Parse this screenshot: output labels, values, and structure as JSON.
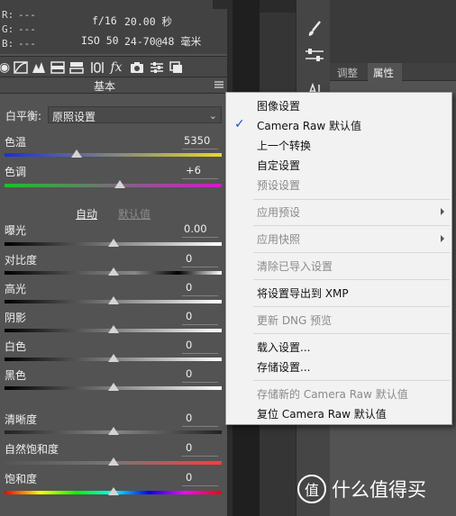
{
  "info": {
    "r_label": "R:",
    "r_value": "---",
    "g_label": "G:",
    "g_value": "---",
    "b_label": "B:",
    "b_value": "---",
    "aperture": "f/16",
    "shutter": "20.00 秒",
    "iso": "ISO 50",
    "lens": "24-70@48 毫米"
  },
  "panel": {
    "title": "基本",
    "white_balance_label": "白平衡:",
    "white_balance_value": "原照设置",
    "auto_label": "自动",
    "default_label": "默认值"
  },
  "sliders": [
    {
      "label": "色温",
      "value": "5350",
      "position": 0.33
    },
    {
      "label": "色调",
      "value": "+6",
      "position": 0.53
    },
    {
      "label": "曝光",
      "value": "0.00",
      "position": 0.5
    },
    {
      "label": "对比度",
      "value": "0",
      "position": 0.5
    },
    {
      "label": "高光",
      "value": "0",
      "position": 0.5
    },
    {
      "label": "阴影",
      "value": "0",
      "position": 0.5
    },
    {
      "label": "白色",
      "value": "0",
      "position": 0.5
    },
    {
      "label": "黑色",
      "value": "0",
      "position": 0.5
    },
    {
      "label": "清晰度",
      "value": "0",
      "position": 0.5
    },
    {
      "label": "自然饱和度",
      "value": "0",
      "position": 0.5
    },
    {
      "label": "饱和度",
      "value": "0",
      "position": 0.5
    }
  ],
  "right_panel": {
    "tab_adjust": "调整",
    "tab_properties": "属性"
  },
  "menu": {
    "items": [
      {
        "label": "图像设置",
        "enabled": true,
        "checked": false
      },
      {
        "label": "Camera Raw 默认值",
        "enabled": true,
        "checked": true
      },
      {
        "label": "上一个转换",
        "enabled": true,
        "checked": false
      },
      {
        "label": "自定设置",
        "enabled": true,
        "checked": false
      },
      {
        "label": "预设设置",
        "enabled": false,
        "checked": false
      },
      {
        "label": "应用预设",
        "enabled": false,
        "submenu": true
      },
      {
        "label": "应用快照",
        "enabled": false,
        "submenu": true
      },
      {
        "label": "清除已导入设置",
        "enabled": false
      },
      {
        "label": "将设置导出到 XMP",
        "enabled": true
      },
      {
        "label": "更新 DNG 预览",
        "enabled": false
      },
      {
        "label": "载入设置...",
        "enabled": true
      },
      {
        "label": "存储设置...",
        "enabled": true
      },
      {
        "label": "存储新的 Camera Raw 默认值",
        "enabled": false
      },
      {
        "label": "复位 Camera Raw 默认值",
        "enabled": true
      }
    ]
  },
  "watermark": {
    "text": "什么值得买",
    "badge": "值"
  }
}
